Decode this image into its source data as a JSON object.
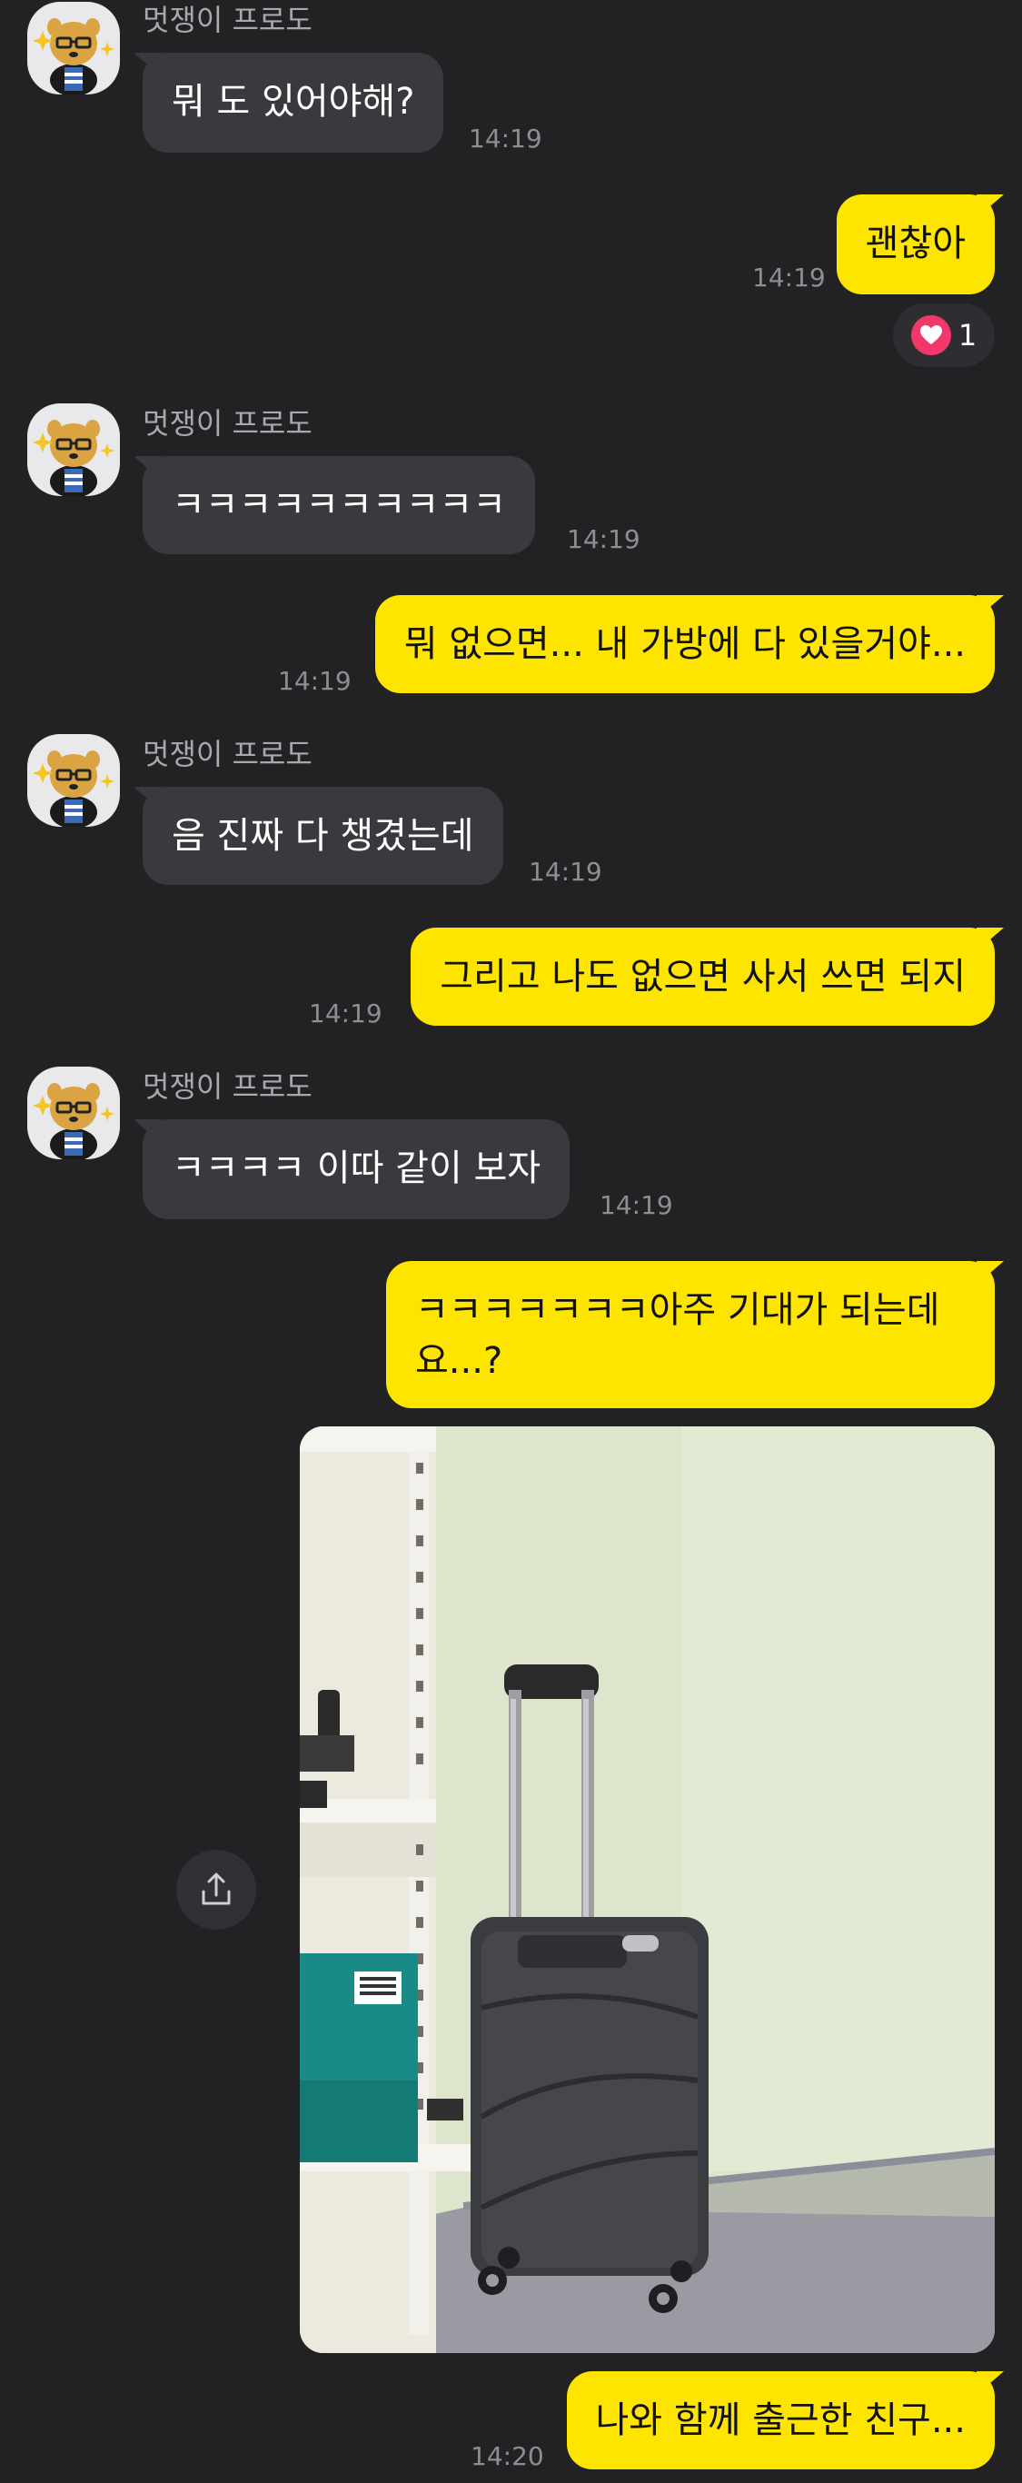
{
  "sender": "멋쟁이 프로도",
  "reaction": {
    "icon": "heart-icon",
    "count": "1"
  },
  "messages": [
    {
      "dir": "in",
      "text": "뭐 도 있어야해?",
      "time": "14:19"
    },
    {
      "dir": "out",
      "text": "괜찮아",
      "time": "14:19"
    },
    {
      "dir": "in",
      "text": "ㅋㅋㅋㅋㅋㅋㅋㅋㅋㅋ",
      "time": "14:19"
    },
    {
      "dir": "out",
      "text": "뭐 없으면... 내 가방에 다 있을거야...",
      "time": "14:19"
    },
    {
      "dir": "in",
      "text": "음 진짜 다 챙겼는데",
      "time": "14:19"
    },
    {
      "dir": "out",
      "text": "그리고 나도 없으면 사서 쓰면 되지",
      "time": "14:19"
    },
    {
      "dir": "in",
      "text": "ㅋㅋㅋㅋ 이따 같이 보자",
      "time": "14:19"
    },
    {
      "dir": "out",
      "text": "ㅋㅋㅋㅋㅋㅋㅋ아주 기대가 되는데\n요...?",
      "time": ""
    },
    {
      "dir": "out",
      "text": "나와 함께 출근한 친구...",
      "time": "14:20"
    }
  ],
  "colors": {
    "background": "#222225",
    "incoming_bubble": "#3a3a3e",
    "outgoing_bubble": "#fee500",
    "reaction_heart": "#f2386b"
  },
  "icons": {
    "share": "share-icon",
    "avatar": "ryan-character-avatar"
  }
}
